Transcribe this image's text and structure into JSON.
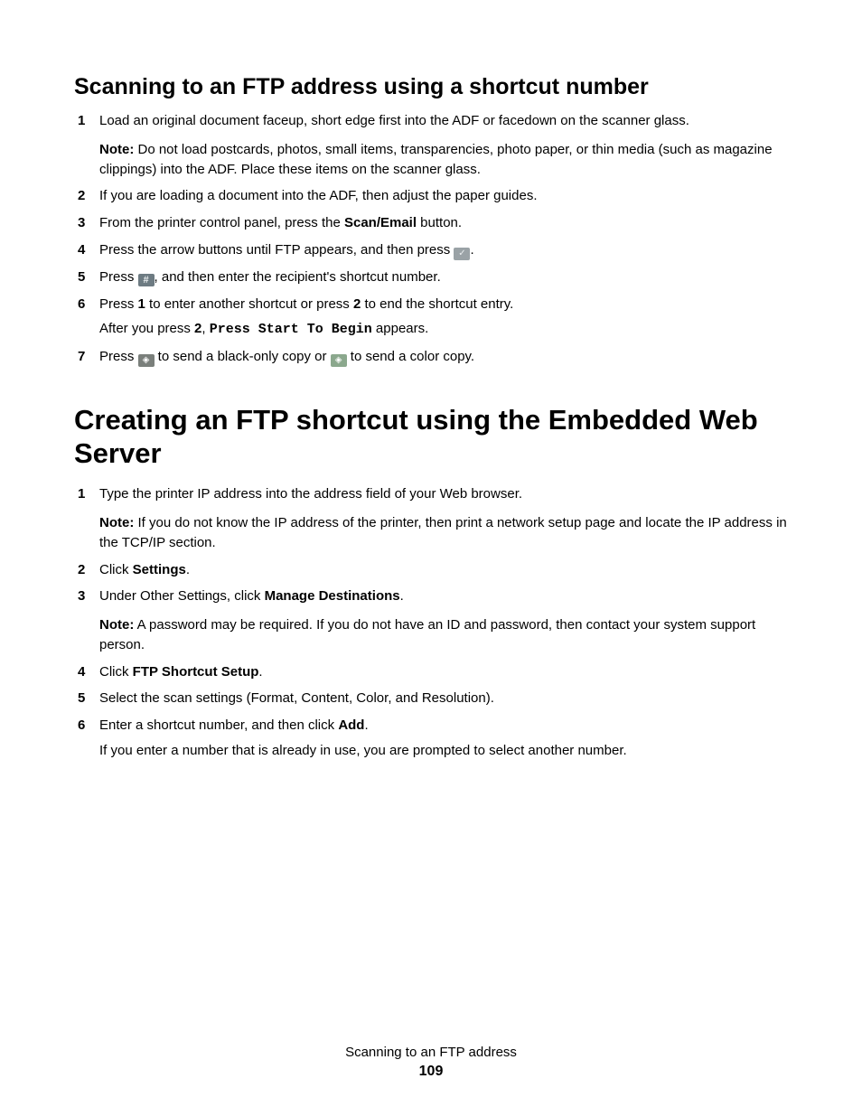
{
  "section1": {
    "title": "Scanning to an FTP address using a shortcut number",
    "steps": {
      "s1": "Load an original document faceup, short edge first into the ADF or facedown on the scanner glass.",
      "note1_label": "Note:",
      "note1_text": " Do not load postcards, photos, small items, transparencies, photo paper, or thin media (such as magazine clippings) into the ADF. Place these items on the scanner glass.",
      "s2": "If you are loading a document into the ADF, then adjust the paper guides.",
      "s3a": "From the printer control panel, press the ",
      "s3b_bold": "Scan/Email",
      "s3c": " button.",
      "s4a": "Press the arrow buttons until FTP appears, and then press ",
      "s4c": ".",
      "s5a": "Press ",
      "s5c": ", and then enter the recipient's shortcut number.",
      "s6a": "Press ",
      "s6_1": "1",
      "s6b": " to enter another shortcut or press ",
      "s6_2": "2",
      "s6c": " to end the shortcut entry.",
      "s6d": "After you press ",
      "s6e": "2",
      "s6f": ", ",
      "s6g_mono": "Press Start To Begin",
      "s6h": " appears.",
      "s7a": "Press ",
      "s7b": " to send a black-only copy or ",
      "s7c": " to send a color copy."
    }
  },
  "section2": {
    "title": "Creating an FTP shortcut using the Embedded Web Server",
    "steps": {
      "s1": "Type the printer IP address into the address field of your Web browser.",
      "note1_label": "Note:",
      "note1_text": " If you do not know the IP address of the printer, then print a network setup page and locate the IP address in the TCP/IP section.",
      "s2a": "Click ",
      "s2b_bold": "Settings",
      "s2c": ".",
      "s3a": "Under Other Settings, click ",
      "s3b_bold": "Manage Destinations",
      "s3c": ".",
      "note2_label": "Note:",
      "note2_text": " A password may be required. If you do not have an ID and password, then contact your system support person.",
      "s4a": "Click ",
      "s4b_bold": "FTP Shortcut Setup",
      "s4c": ".",
      "s5": "Select the scan settings (Format, Content, Color, and Resolution).",
      "s6a": "Enter a shortcut number, and then click ",
      "s6b_bold": "Add",
      "s6c": ".",
      "s6d": "If you enter a number that is already in use, you are prompted to select another number."
    }
  },
  "icons": {
    "check": "✓",
    "hash": "#",
    "diamond_black": "◈",
    "diamond_color": "◈"
  },
  "footer": {
    "title": "Scanning to an FTP address",
    "page": "109"
  }
}
